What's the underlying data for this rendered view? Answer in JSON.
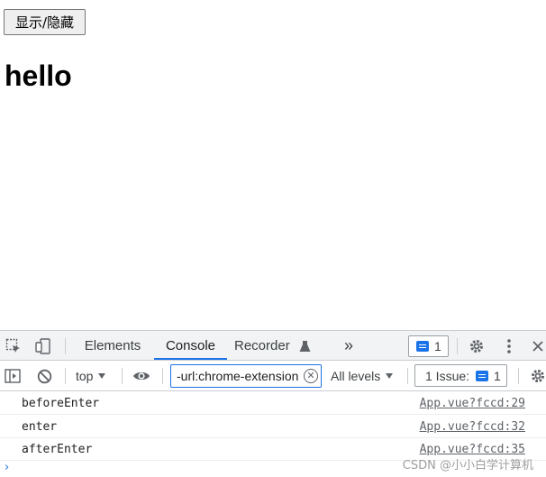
{
  "page": {
    "toggle_button": "显示/隐藏",
    "heading": "hello"
  },
  "devtools": {
    "tabs": [
      {
        "label": "Elements"
      },
      {
        "label": "Console",
        "active": true
      },
      {
        "label": "Recorder"
      }
    ],
    "more_tabs": "»",
    "message_count": "1",
    "context": "top",
    "filter_text": "-url:chrome-extension",
    "log_levels": "All levels",
    "issues_label": "1 Issue:",
    "issues_count": "1",
    "accent_color": "#1a73e8"
  },
  "console": {
    "rows": [
      {
        "message": "beforeEnter",
        "source": "App.vue?fccd:29"
      },
      {
        "message": "enter",
        "source": "App.vue?fccd:32"
      },
      {
        "message": "afterEnter",
        "source": "App.vue?fccd:35"
      }
    ],
    "prompt": "›"
  },
  "watermark": "CSDN @小小白学计算机"
}
